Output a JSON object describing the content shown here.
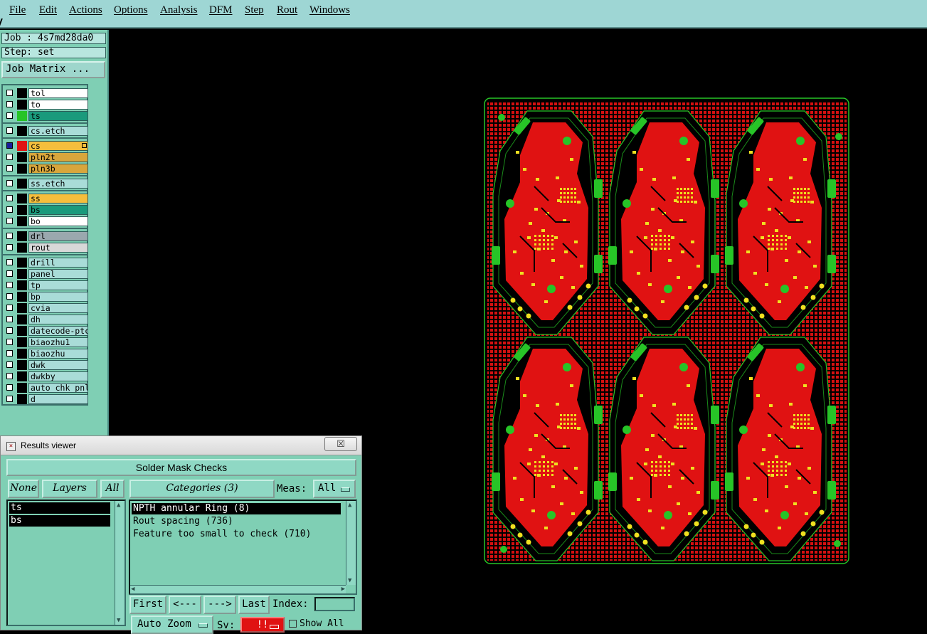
{
  "menubar": {
    "items": [
      "File",
      "Edit",
      "Actions",
      "Options",
      "Analysis",
      "DFM",
      "Step",
      "Rout",
      "Windows"
    ]
  },
  "left_panel": {
    "job": "Job : 4s7md28da0",
    "step": "Step: set",
    "job_matrix_button": "Job Matrix ..."
  },
  "layers": [
    {
      "name": "tol",
      "color": "#ffffff",
      "active_swatch": "#000000",
      "checked": false
    },
    {
      "name": "to",
      "color": "#ffffff",
      "active_swatch": "#000000",
      "checked": false
    },
    {
      "name": "ts",
      "color": "#1a9a7c",
      "active_swatch": "#27c427",
      "checked": false
    },
    {
      "name": "cs.etch",
      "color": "#a9dcd8",
      "active_swatch": "#000000",
      "checked": false
    },
    {
      "name": "cs",
      "color": "#f5be3c",
      "active_swatch": "#e01212",
      "checked": true
    },
    {
      "name": "pln2t",
      "color": "#d8a63c",
      "active_swatch": "#000000",
      "checked": false
    },
    {
      "name": "pln3b",
      "color": "#d8a63c",
      "active_swatch": "#000000",
      "checked": false
    },
    {
      "name": "ss.etch",
      "color": "#a9dcd8",
      "active_swatch": "#000000",
      "checked": false
    },
    {
      "name": "ss",
      "color": "#f5be3c",
      "active_swatch": "#000000",
      "checked": false
    },
    {
      "name": "bs",
      "color": "#1a9a7c",
      "active_swatch": "#000000",
      "checked": false
    },
    {
      "name": "bo",
      "color": "#ffffff",
      "active_swatch": "#000000",
      "checked": false
    },
    {
      "name": "drl",
      "color": "#9aa8ae",
      "active_swatch": "#000000",
      "checked": false
    },
    {
      "name": "rout",
      "color": "#d8d8d8",
      "active_swatch": "#000000",
      "checked": false
    },
    {
      "name": "drill",
      "color": "#a9dcd8",
      "active_swatch": "#000000",
      "checked": false
    },
    {
      "name": "panel",
      "color": "#a9dcd8",
      "active_swatch": "#000000",
      "checked": false
    },
    {
      "name": "tp",
      "color": "#a9dcd8",
      "active_swatch": "#000000",
      "checked": false
    },
    {
      "name": "bp",
      "color": "#a9dcd8",
      "active_swatch": "#000000",
      "checked": false
    },
    {
      "name": "cvia",
      "color": "#a9dcd8",
      "active_swatch": "#000000",
      "checked": false
    },
    {
      "name": "dh",
      "color": "#a9dcd8",
      "active_swatch": "#000000",
      "checked": false
    },
    {
      "name": "datecode-ptc",
      "color": "#a9dcd8",
      "active_swatch": "#000000",
      "checked": false
    },
    {
      "name": "biaozhu1",
      "color": "#a9dcd8",
      "active_swatch": "#000000",
      "checked": false
    },
    {
      "name": "biaozhu",
      "color": "#a9dcd8",
      "active_swatch": "#000000",
      "checked": false
    },
    {
      "name": "dwk",
      "color": "#a9dcd8",
      "active_swatch": "#000000",
      "checked": false
    },
    {
      "name": "dwkby",
      "color": "#a9dcd8",
      "active_swatch": "#000000",
      "checked": false
    },
    {
      "name": "auto_chk_pnl",
      "color": "#a9dcd8",
      "active_swatch": "#000000",
      "checked": false
    },
    {
      "name": "d",
      "color": "#a9dcd8",
      "active_swatch": "#000000",
      "checked": false
    }
  ],
  "results_viewer": {
    "title": "Results viewer",
    "close_symbol": "☒",
    "header": "Solder Mask Checks",
    "none_button": "None",
    "layers_button": "Layers",
    "all_button": "All",
    "categories_button": "Categories (3)",
    "meas_label": "Meas:",
    "meas_value": "All",
    "layer_items": [
      "ts",
      "bs"
    ],
    "category_items": [
      "NPTH annular Ring (8)",
      "Rout spacing (736)",
      "Feature too small to check (710)"
    ],
    "selected_category": 0,
    "first_button": "First",
    "prev_button": "<---",
    "next_button": "--->",
    "last_button": "Last",
    "index_label": "Index:",
    "index_value": "",
    "autozoom_button": "Auto Zoom",
    "sev_label": "Sv:",
    "sev_value": "!!",
    "show_all_label": "Show All"
  },
  "colors": {
    "panel_bg": "#7fcfb4",
    "menubar_bg": "#9ed6d4",
    "board_copper": "#e01212",
    "board_outline": "#27c427",
    "pads": "#f0e020"
  }
}
